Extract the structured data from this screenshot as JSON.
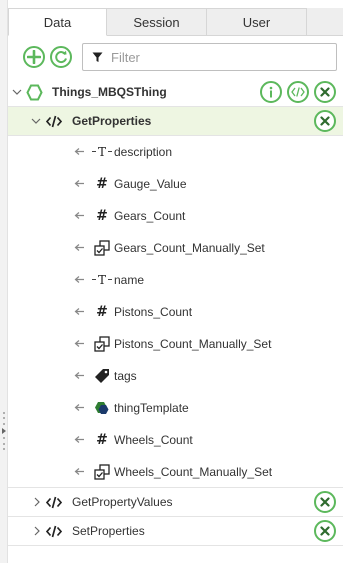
{
  "tabs": [
    {
      "label": "Data",
      "active": true
    },
    {
      "label": "Session",
      "active": false
    },
    {
      "label": "User",
      "active": false
    }
  ],
  "toolbar": {
    "add_icon": "plus-circle-icon",
    "refresh_icon": "refresh-icon",
    "filter_icon": "filter-icon",
    "filter_placeholder": "Filter",
    "filter_value": ""
  },
  "tree": {
    "thing": {
      "label": "Things_MBQSThing",
      "icon": "thing-hexagon-icon",
      "actions": [
        "info-icon",
        "code-icon",
        "remove-icon"
      ]
    },
    "services": [
      {
        "label": "GetProperties",
        "expanded": true,
        "properties": [
          {
            "label": "description",
            "type": "string"
          },
          {
            "label": "Gauge_Value",
            "type": "number"
          },
          {
            "label": "Gears_Count",
            "type": "number"
          },
          {
            "label": "Gears_Count_Manually_Set",
            "type": "boolean"
          },
          {
            "label": "name",
            "type": "string"
          },
          {
            "label": "Pistons_Count",
            "type": "number"
          },
          {
            "label": "Pistons_Count_Manually_Set",
            "type": "boolean"
          },
          {
            "label": "tags",
            "type": "tags"
          },
          {
            "label": "thingTemplate",
            "type": "thingtemplate"
          },
          {
            "label": "Wheels_Count",
            "type": "number"
          },
          {
            "label": "Wheels_Count_Manually_Set",
            "type": "boolean"
          }
        ]
      },
      {
        "label": "GetPropertyValues",
        "expanded": false
      },
      {
        "label": "SetProperties",
        "expanded": false
      }
    ]
  },
  "colors": {
    "accent_green": "#5cb85c",
    "selected_bg": "#eef6e2",
    "tab_bg": "#eeeeee"
  }
}
